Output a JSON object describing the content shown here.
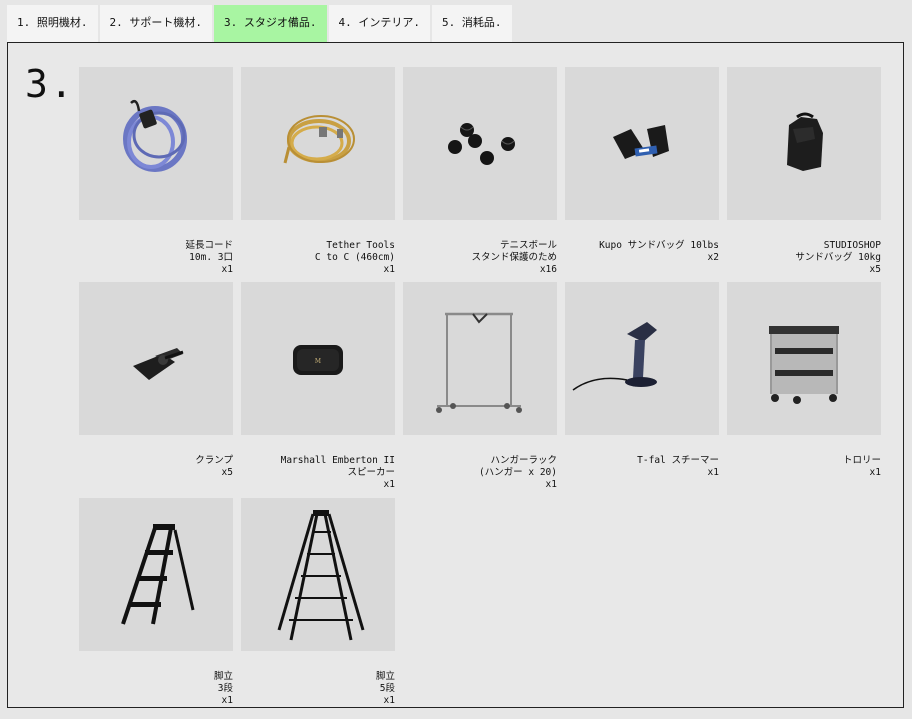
{
  "tabs": [
    {
      "label": "1. 照明機材."
    },
    {
      "label": "2. サポート機材."
    },
    {
      "label": "3. スタジオ備品."
    },
    {
      "label": "4. インテリア."
    },
    {
      "label": "5. 消耗品."
    }
  ],
  "active_tab": 2,
  "section_number": "3.",
  "colors": {
    "active_tab": "#a8f5a2",
    "photo_bg": "#d9d9d9"
  },
  "items": [
    {
      "line1": "延長コード",
      "line2": "10m. 3口",
      "qty": "x1",
      "icon": "extension-cord"
    },
    {
      "line1": "Tether Tools",
      "line2": "C to C (460cm)",
      "qty": "x1",
      "icon": "cable"
    },
    {
      "line1": "テニスボール",
      "line2": "スタンド保護のため",
      "qty": "x16",
      "icon": "tennis-balls"
    },
    {
      "line1": "Kupo サンドバッグ 10lbs",
      "line2": "",
      "qty": "x2",
      "icon": "sandbag"
    },
    {
      "line1": "STUDIOSHOP",
      "line2": "サンドバッグ 10kg",
      "qty": "x5",
      "icon": "sandbag"
    },
    {
      "line1": "クランプ",
      "line2": "",
      "qty": "x5",
      "icon": "clamp"
    },
    {
      "line1": "Marshall Emberton II",
      "line2": "スピーカー",
      "qty": "x1",
      "icon": "speaker"
    },
    {
      "line1": "ハンガーラック",
      "line2": "(ハンガー x 20)",
      "qty": "x1",
      "icon": "hanger-rack"
    },
    {
      "line1": "T-fal スチーマー",
      "line2": "",
      "qty": "x1",
      "icon": "steamer"
    },
    {
      "line1": "トロリー",
      "line2": "",
      "qty": "x1",
      "icon": "trolley"
    },
    {
      "line1": "脚立",
      "line2": "3段",
      "qty": "x1",
      "icon": "step-stool"
    },
    {
      "line1": "脚立",
      "line2": "5段",
      "qty": "x1",
      "icon": "ladder"
    }
  ]
}
